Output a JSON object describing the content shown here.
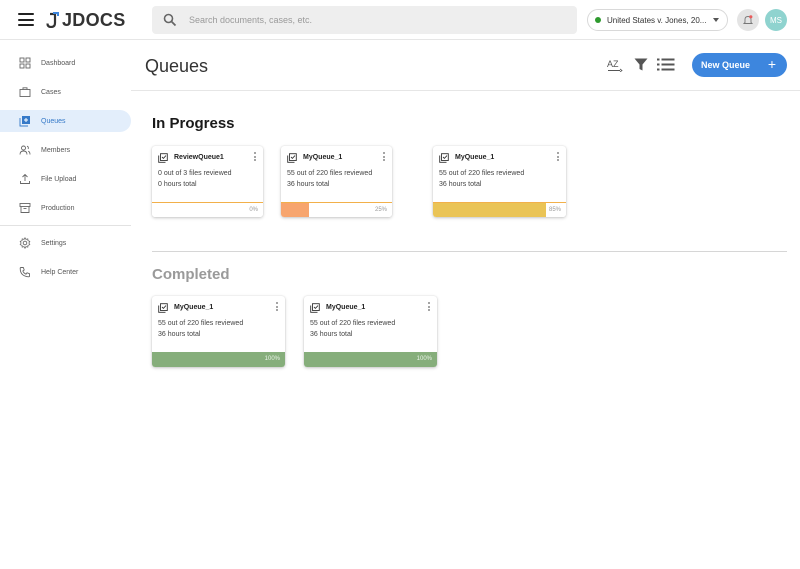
{
  "app": {
    "logo": "JDOCS"
  },
  "search": {
    "placeholder": "Search documents, cases, etc."
  },
  "case_selector": {
    "value": "United States v. Jones, 20..."
  },
  "user": {
    "initials": "MS"
  },
  "sidebar": {
    "items": [
      {
        "label": "Dashboard",
        "icon": "dashboard-icon",
        "active": false
      },
      {
        "label": "Cases",
        "icon": "briefcase-icon",
        "active": false
      },
      {
        "label": "Queues",
        "icon": "queue-add-icon",
        "active": true
      },
      {
        "label": "Members",
        "icon": "people-icon",
        "active": false
      },
      {
        "label": "File Upload",
        "icon": "upload-icon",
        "active": false
      },
      {
        "label": "Production",
        "icon": "archive-icon",
        "active": false
      },
      {
        "label": "Settings",
        "icon": "gear-icon",
        "active": false
      },
      {
        "label": "Help Center",
        "icon": "phone-icon",
        "active": false
      }
    ]
  },
  "header": {
    "title": "Queues",
    "sort_label": "AZ",
    "new_queue_label": "New Queue",
    "new_queue_plus": "+"
  },
  "sections": {
    "in_progress": "In Progress",
    "completed": "Completed"
  },
  "in_progress_cards": [
    {
      "name": "ReviewQueue1",
      "line1": "0 out of 3 files reviewed",
      "line2": "0 hours total",
      "progress": 0,
      "progress_label": "0%",
      "color": "#f2b04a"
    },
    {
      "name": "MyQueue_1",
      "line1": "55 out of 220 files reviewed",
      "line2": "36 hours total",
      "progress": 0.25,
      "progress_label": "25%",
      "color": "#f7a56e"
    },
    {
      "name": "MyQueue_1",
      "line1": "55 out of 220 files reviewed",
      "line2": "36 hours total",
      "progress": 0.85,
      "progress_label": "85%",
      "color": "#eac456"
    }
  ],
  "completed_cards": [
    {
      "name": "MyQueue_1",
      "line1": "55 out of 220 files reviewed",
      "line2": "36 hours total",
      "progress": 1,
      "progress_label": "100%",
      "color": "#86ae7b"
    },
    {
      "name": "MyQueue_1",
      "line1": "55 out of 220 files reviewed",
      "line2": "36 hours total",
      "progress": 1,
      "progress_label": "100%",
      "color": "#86ae7b"
    }
  ],
  "colors": {
    "accent": "#3d86de",
    "active_bg": "#e3eefb",
    "status_online": "#2e9a2e",
    "avatar": "#8fd3cf"
  }
}
